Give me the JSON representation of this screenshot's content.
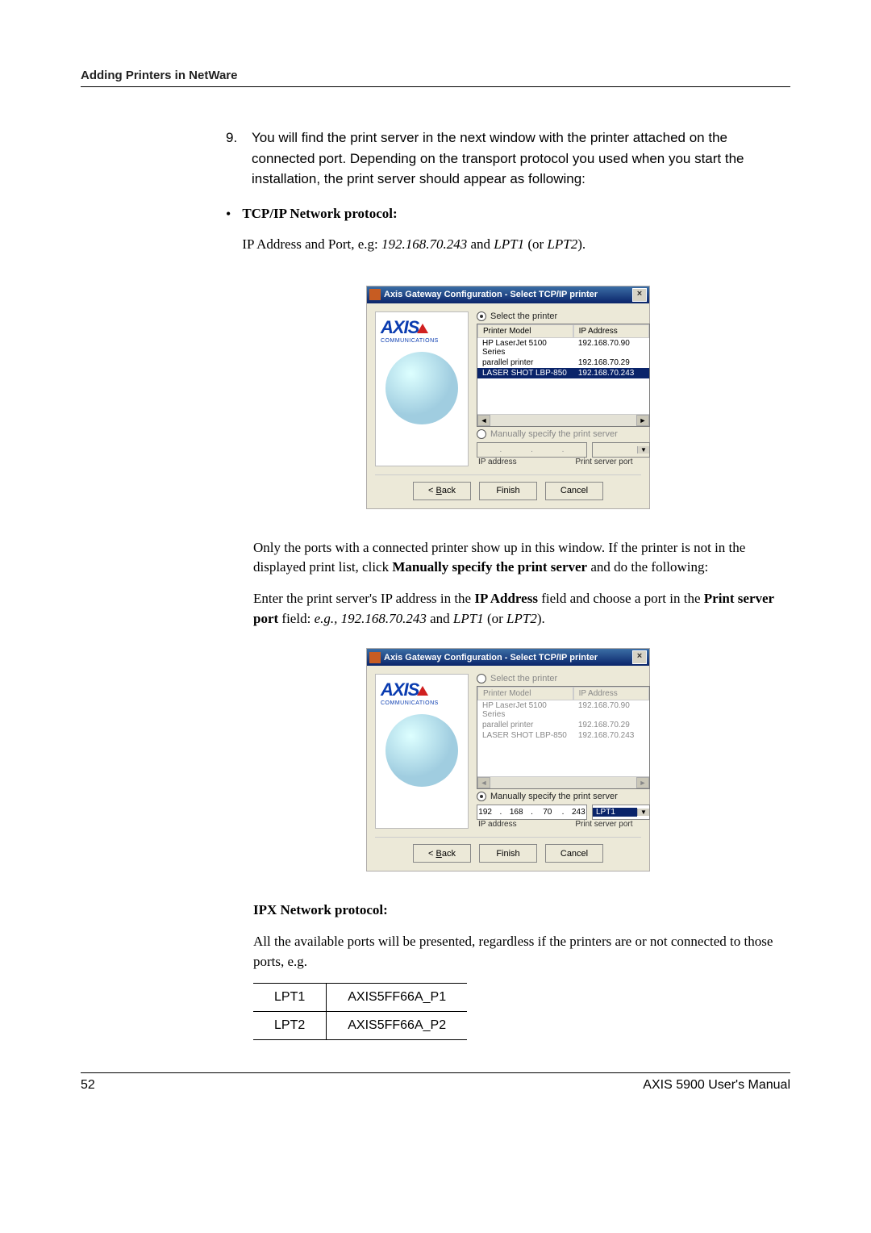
{
  "header": "Adding Printers in NetWare",
  "step9_num": "9.",
  "step9_text": "You will find the print server in the next window with the printer attached on the connected port. Depending on the transport protocol you used when you start the installation, the print server should appear as following:",
  "bullet_char": "•",
  "tcp_title": "TCP/IP Network protocol:",
  "tcp_line1a": "IP Address and Port, e.g: ",
  "tcp_line1b": "192.168.70.243",
  "tcp_line1c": " and ",
  "tcp_line1d": "LPT1",
  "tcp_line1e": " (or ",
  "tcp_line1f": "LPT2",
  "tcp_line1g": ").",
  "dialog": {
    "title": "Axis Gateway Configuration - Select TCP/IP printer",
    "close": "×",
    "logo": "AXIS",
    "logo_sub": "COMMUNICATIONS",
    "r_select": "Select the printer",
    "r_manual": "Manually specify the print server",
    "col_model": "Printer Model",
    "col_ip": "IP Address",
    "rows": [
      {
        "model": "HP LaserJet 5100 Series",
        "ip": "192.168.70.90"
      },
      {
        "model": "parallel printer",
        "ip": "192.168.70.29"
      },
      {
        "model": "LASER SHOT LBP-850",
        "ip": "192.168.70.243"
      }
    ],
    "lbl_ip": "IP address",
    "lbl_port": "Print server port",
    "ip_parts": [
      "192",
      "168",
      "70",
      "243"
    ],
    "port_val": "LPT1",
    "btn_back": "< Back",
    "btn_back_u": "B",
    "btn_finish": "Finish",
    "btn_cancel": "Cancel"
  },
  "para_only_1": "Only the ports with a connected printer show up in this window. If the printer is not in the displayed print list, click ",
  "para_only_2": "Manually specify the print server",
  "para_only_3": " and do the following:",
  "para_enter_1": "Enter the print server's IP address in the ",
  "para_enter_2": "IP Address",
  "para_enter_3": " field and choose a port in the ",
  "para_enter_4": "Print server port",
  "para_enter_5": " field: ",
  "para_enter_6": "e.g., 192.168.70.243",
  "para_enter_7": " and ",
  "para_enter_8": "LPT1",
  "para_enter_9": " (or ",
  "para_enter_10": "LPT2",
  "para_enter_11": ").",
  "ipx_title": "IPX Network protocol:",
  "ipx_text": "All the available ports will be presented, regardless if the printers are or not connected to those ports, e.g.",
  "port_table": {
    "r1c1": "LPT1",
    "r1c2": "AXIS5FF66A_P1",
    "r2c1": "LPT2",
    "r2c2": "AXIS5FF66A_P2"
  },
  "footer": {
    "page": "52",
    "manual": "AXIS 5900 User's Manual"
  }
}
